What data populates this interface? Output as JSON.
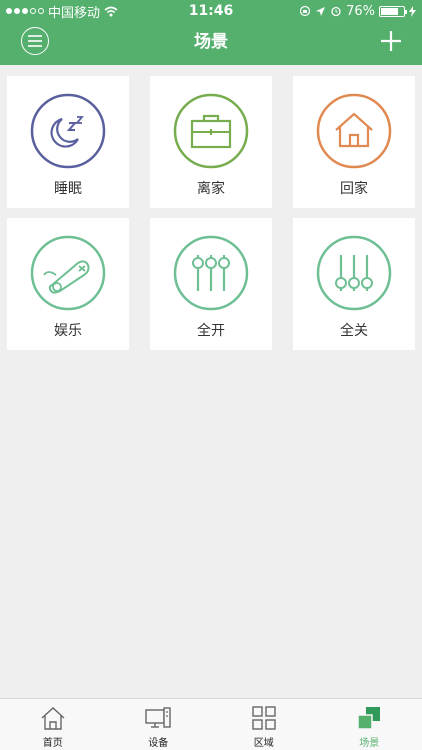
{
  "status": {
    "carrier": "中国移动",
    "time": "11:46",
    "battery": "76%",
    "battery_level": 0.76
  },
  "nav": {
    "title": "场景"
  },
  "scenes": [
    {
      "label": "睡眠",
      "icon": "sleep-icon",
      "color": "#5a5f9e"
    },
    {
      "label": "离家",
      "icon": "briefcase-icon",
      "color": "#77ad4f"
    },
    {
      "label": "回家",
      "icon": "home-icon",
      "color": "#e08a52"
    },
    {
      "label": "娱乐",
      "icon": "gamepad-icon",
      "color": "#6ebf94"
    },
    {
      "label": "全开",
      "icon": "sliders-up-icon",
      "color": "#6ebf94"
    },
    {
      "label": "全关",
      "icon": "sliders-down-icon",
      "color": "#6ebf94"
    }
  ],
  "tabs": [
    {
      "label": "首页",
      "icon": "home-tab-icon"
    },
    {
      "label": "设备",
      "icon": "device-tab-icon"
    },
    {
      "label": "区域",
      "icon": "area-tab-icon"
    },
    {
      "label": "场景",
      "icon": "scene-tab-icon",
      "active": true
    }
  ],
  "colors": {
    "accent": "#55b06e",
    "background": "#efefef"
  }
}
